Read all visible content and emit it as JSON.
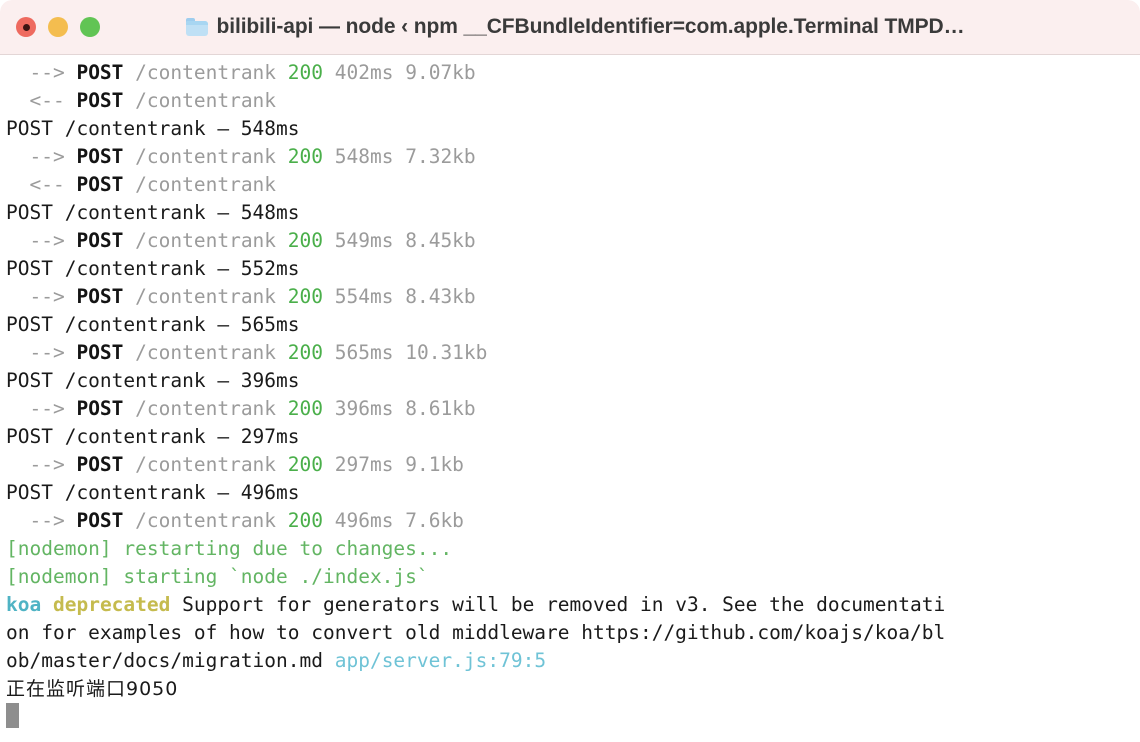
{
  "window": {
    "title": "bilibili-api — node ‹ npm __CFBundleIdentifier=com.apple.Terminal TMPD…",
    "folder_icon": "folder-icon",
    "traffic_lights": [
      {
        "name": "close-button",
        "color": "#ee6a5f"
      },
      {
        "name": "minimize-button",
        "color": "#f4bd4f"
      },
      {
        "name": "zoom-button",
        "color": "#61c454"
      }
    ]
  },
  "colors": {
    "titlebar_bg": "#fbefef",
    "terminal_bg": "#ffffff",
    "status_ok": "#4aaf4a",
    "nodemon": "#63b563",
    "koa_tag": "#4fb3c4",
    "deprecated_tag": "#c5bb4e",
    "cyan_path": "#6fc3d6",
    "dim_text": "#9b9b9b",
    "cursor": "#8e8e8e"
  },
  "terminal": {
    "lines": [
      {
        "type": "response",
        "arrow": "  --> ",
        "method": "POST",
        "path": " /contentrank ",
        "status": "200",
        "time": " 402ms ",
        "size": "9.07kb"
      },
      {
        "type": "request",
        "arrow": "  <-- ",
        "method": "POST",
        "path": " /contentrank"
      },
      {
        "type": "summary",
        "text": "POST /contentrank — 548ms"
      },
      {
        "type": "response",
        "arrow": "  --> ",
        "method": "POST",
        "path": " /contentrank ",
        "status": "200",
        "time": " 548ms ",
        "size": "7.32kb"
      },
      {
        "type": "request",
        "arrow": "  <-- ",
        "method": "POST",
        "path": " /contentrank"
      },
      {
        "type": "summary",
        "text": "POST /contentrank — 548ms"
      },
      {
        "type": "response",
        "arrow": "  --> ",
        "method": "POST",
        "path": " /contentrank ",
        "status": "200",
        "time": " 549ms ",
        "size": "8.45kb"
      },
      {
        "type": "summary",
        "text": "POST /contentrank — 552ms"
      },
      {
        "type": "response",
        "arrow": "  --> ",
        "method": "POST",
        "path": " /contentrank ",
        "status": "200",
        "time": " 554ms ",
        "size": "8.43kb"
      },
      {
        "type": "summary",
        "text": "POST /contentrank — 565ms"
      },
      {
        "type": "response",
        "arrow": "  --> ",
        "method": "POST",
        "path": " /contentrank ",
        "status": "200",
        "time": " 565ms ",
        "size": "10.31kb"
      },
      {
        "type": "summary",
        "text": "POST /contentrank — 396ms"
      },
      {
        "type": "response",
        "arrow": "  --> ",
        "method": "POST",
        "path": " /contentrank ",
        "status": "200",
        "time": " 396ms ",
        "size": "8.61kb"
      },
      {
        "type": "summary",
        "text": "POST /contentrank — 297ms"
      },
      {
        "type": "response",
        "arrow": "  --> ",
        "method": "POST",
        "path": " /contentrank ",
        "status": "200",
        "time": " 297ms ",
        "size": "9.1kb"
      },
      {
        "type": "summary",
        "text": "POST /contentrank — 496ms"
      },
      {
        "type": "response",
        "arrow": "  --> ",
        "method": "POST",
        "path": " /contentrank ",
        "status": "200",
        "time": " 496ms ",
        "size": "7.6kb"
      },
      {
        "type": "nodemon",
        "text": "[nodemon] restarting due to changes..."
      },
      {
        "type": "nodemon",
        "text": "[nodemon] starting `node ./index.js`"
      }
    ],
    "deprecation": {
      "tag": "koa",
      "label": "deprecated",
      "message_part1": " Support for generators will be removed in v3. See the documentati",
      "message_part2": "on for examples of how to convert old middleware https://github.com/koajs/koa/bl",
      "message_part3": "ob/master/docs/migration.md ",
      "source_ref": "app/server.js:79:5"
    },
    "listening": "正在监听端口9050",
    "cursor": "block-cursor"
  }
}
